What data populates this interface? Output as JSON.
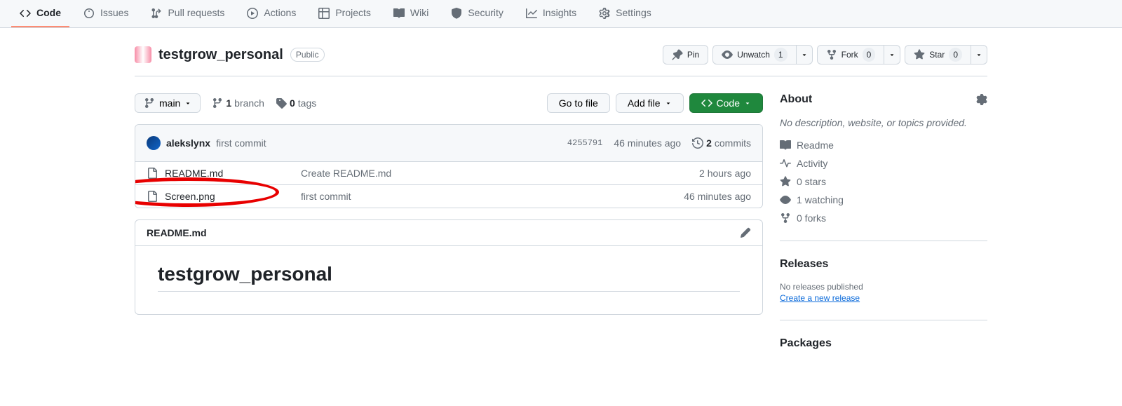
{
  "nav": {
    "code": "Code",
    "issues": "Issues",
    "pulls": "Pull requests",
    "actions": "Actions",
    "projects": "Projects",
    "wiki": "Wiki",
    "security": "Security",
    "insights": "Insights",
    "settings": "Settings"
  },
  "repo": {
    "name": "testgrow_personal",
    "visibility": "Public"
  },
  "actions": {
    "pin": "Pin",
    "unwatch": "Unwatch",
    "unwatch_count": "1",
    "fork": "Fork",
    "fork_count": "0",
    "star": "Star",
    "star_count": "0"
  },
  "branchbar": {
    "branch": "main",
    "branches_num": "1",
    "branches_label": "branch",
    "tags_num": "0",
    "tags_label": "tags",
    "goto_file": "Go to file",
    "add_file": "Add file",
    "code": "Code"
  },
  "latest": {
    "author": "alekslynx",
    "message": "first commit",
    "sha": "4255791",
    "time": "46 minutes ago",
    "commits_num": "2",
    "commits_label": "commits"
  },
  "files": [
    {
      "name": "README.md",
      "message": "Create README.md",
      "time": "2 hours ago"
    },
    {
      "name": "Screen.png",
      "message": "first commit",
      "time": "46 minutes ago"
    }
  ],
  "readme": {
    "filename": "README.md",
    "heading": "testgrow_personal"
  },
  "sidebar": {
    "about": "About",
    "description": "No description, website, or topics provided.",
    "readme": "Readme",
    "activity": "Activity",
    "stars": "0 stars",
    "watching": "1 watching",
    "forks": "0 forks",
    "releases": "Releases",
    "no_releases": "No releases published",
    "create_release": "Create a new release",
    "packages": "Packages"
  },
  "annotation": {
    "highlight_file": "Screen.png"
  }
}
